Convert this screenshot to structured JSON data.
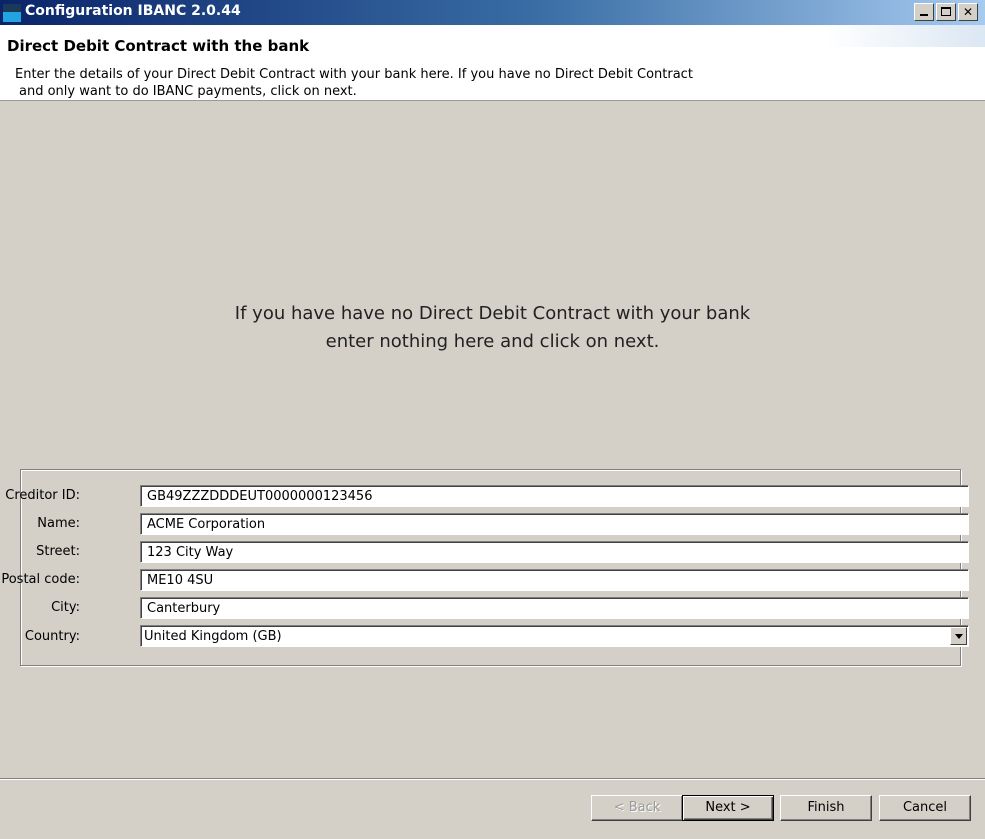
{
  "window": {
    "title": "Configuration IBANC 2.0.44",
    "minimize": "_",
    "maximize": "□",
    "close": "✕"
  },
  "header": {
    "title": "Direct Debit Contract with the bank",
    "description_line1": "Enter the details of your Direct Debit Contract with your bank here. If you have no Direct Debit Contract",
    "description_line2": "and only want to do IBANC payments, click on next."
  },
  "info": {
    "line1": "If you have have no Direct Debit Contract with your bank",
    "line2": "enter nothing here and click on next."
  },
  "form": {
    "creditor_id": {
      "label": "Creditor ID:",
      "value": "GB49ZZZDDDEUT0000000123456"
    },
    "name": {
      "label": "Name:",
      "value": "ACME Corporation"
    },
    "street": {
      "label": "Street:",
      "value": "123 City Way"
    },
    "postal_code": {
      "label": "Postal code:",
      "value": "ME10 4SU"
    },
    "city": {
      "label": "City:",
      "value": "Canterbury"
    },
    "country": {
      "label": "Country:",
      "value": "United Kingdom (GB)"
    }
  },
  "buttons": {
    "back": "< Back",
    "next": "Next >",
    "finish": "Finish",
    "cancel": "Cancel"
  },
  "icons": {
    "app": "app-icon",
    "dropdown": "chevron-down-icon"
  }
}
